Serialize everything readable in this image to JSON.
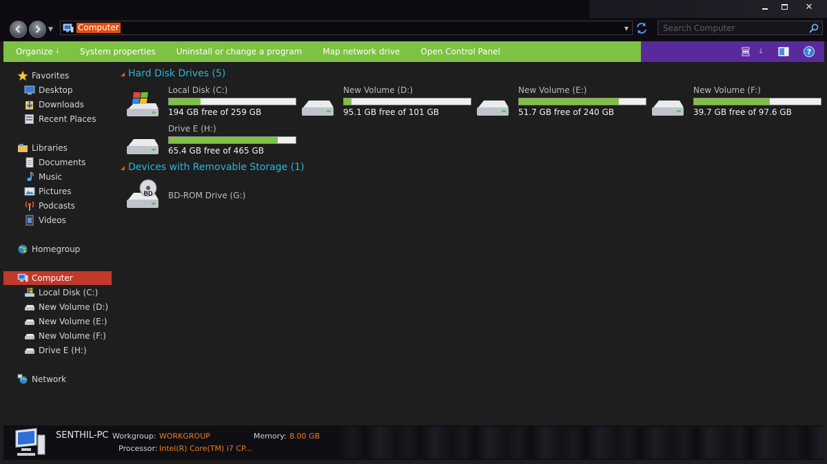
{
  "window": {
    "controls": {
      "minimize": "minimize",
      "maximize": "maximize",
      "close": "✕"
    }
  },
  "address": {
    "path": "Computer",
    "search_placeholder": "Search Computer"
  },
  "toolbar": {
    "commands": [
      {
        "label": "Organize",
        "has_arrow": true
      },
      {
        "label": "System properties"
      },
      {
        "label": "Uninstall or change a program"
      },
      {
        "label": "Map network drive"
      },
      {
        "label": "Open Control Panel"
      }
    ],
    "right_icons": [
      "view-options-icon",
      "more-options-icon",
      "preview-pane-icon",
      "help-icon"
    ],
    "help_label": "?"
  },
  "sidebar": {
    "favorites": {
      "label": "Favorites",
      "items": [
        "Desktop",
        "Downloads",
        "Recent Places"
      ]
    },
    "libraries": {
      "label": "Libraries",
      "items": [
        "Documents",
        "Music",
        "Pictures",
        "Podcasts",
        "Videos"
      ]
    },
    "homegroup": {
      "label": "Homegroup"
    },
    "computer": {
      "label": "Computer",
      "items": [
        "Local Disk (C:)",
        "New Volume (D:)",
        "New Volume (E:)",
        "New Volume (F:)",
        "Drive E (H:)"
      ]
    },
    "network": {
      "label": "Network"
    }
  },
  "content": {
    "hard_disks": {
      "title": "Hard Disk Drives (5)",
      "drives": [
        {
          "name": "Local Disk (C:)",
          "free": "194 GB free of 259 GB",
          "used_fraction": 0.25
        },
        {
          "name": "New Volume (D:)",
          "free": "95.1 GB free of 101 GB",
          "used_fraction": 0.06
        },
        {
          "name": "New Volume (E:)",
          "free": "51.7 GB free of 240 GB",
          "used_fraction": 0.79
        },
        {
          "name": "New Volume (F:)",
          "free": "39.7 GB free of 97.6 GB",
          "used_fraction": 0.6
        },
        {
          "name": "Drive E (H:)",
          "free": "65.4 GB free of 465 GB",
          "used_fraction": 0.86
        }
      ]
    },
    "removable": {
      "title": "Devices with Removable Storage (1)",
      "devices": [
        {
          "name": "BD-ROM Drive (G:)",
          "badge": "BD"
        }
      ]
    }
  },
  "details": {
    "pc_name": "SENTHIL-PC",
    "workgroup_label": "Workgroup:",
    "workgroup_value": "WORKGROUP",
    "memory_label": "Memory:",
    "memory_value": "8.00 GB",
    "processor_label": "Processor:",
    "processor_value": "Intel(R) Core(TM) i7 CP..."
  }
}
